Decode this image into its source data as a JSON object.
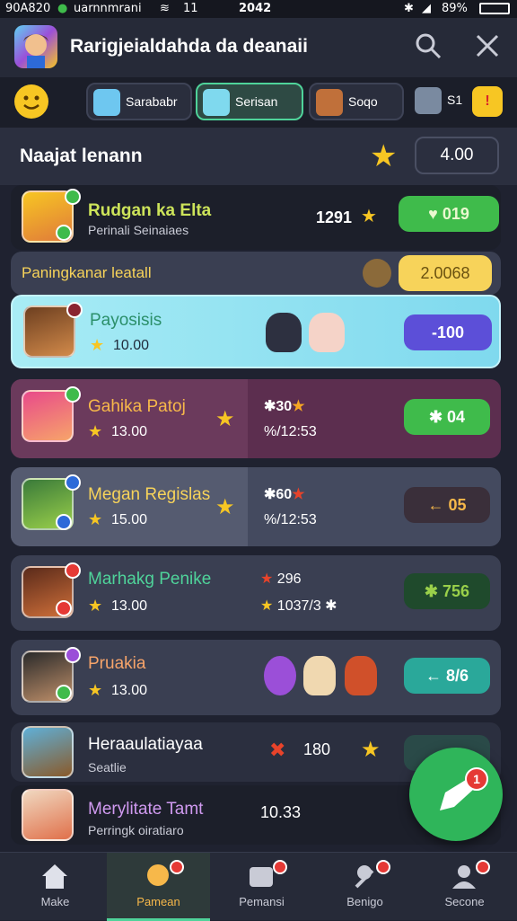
{
  "status": {
    "left": "90A820",
    "carrier": "uarnnmrani",
    "signal_num": "11",
    "time": "2042",
    "battery": "89%"
  },
  "header": {
    "title": "Rarigjeialdahda da deanaii"
  },
  "chips": [
    {
      "label": "Sarababr"
    },
    {
      "label": "Serisan"
    },
    {
      "label": "Soqo"
    },
    {
      "label": "S1"
    }
  ],
  "section": {
    "title": "Naajat lenann",
    "value": "4.00"
  },
  "rows": [
    {
      "name": "Rudgan ka Elta",
      "sub": "Perinali Seinaiaes",
      "score": "1291",
      "pill": "019",
      "name_color": "#cde45a",
      "pill_color": "#3fbb4b"
    },
    {
      "name": "Paningkanar leatall",
      "pill": "2.0068",
      "pill_color": "#f7d35a"
    },
    {
      "name": "Payosisis",
      "points": "10.00",
      "pill": "-100",
      "pill_color": "#5c4fd8"
    },
    {
      "name": "Gahika Patoj",
      "points": "13.00",
      "stat1": "30",
      "stat2": "/12:53",
      "pill": "04",
      "pill_color": "#3fbb4b"
    },
    {
      "name": "Megan Regislas",
      "points": "15.00",
      "stat1": "60",
      "stat2": "/12:53",
      "pill": "05",
      "pill_color": "#3a2f3a"
    },
    {
      "name": "Marhakg Penike",
      "points": "13.00",
      "stat1": "296",
      "stat2": "1037/3",
      "pill": "756",
      "pill_color": "#1f4a2c"
    },
    {
      "name": "Pruakia",
      "points": "13.00",
      "pill": "8/6",
      "pill_color": "#2aa89a"
    },
    {
      "name": "Heraaulatiayaa",
      "sub": "Seatlie",
      "score": "180"
    },
    {
      "name": "Merylitate Tamt",
      "sub": "Perringk oiratiaro",
      "score": "10.33"
    }
  ],
  "fab": {
    "badge": "1"
  },
  "nav": [
    {
      "label": "Make"
    },
    {
      "label": "Pamean"
    },
    {
      "label": "Pemansi"
    },
    {
      "label": "Benigo"
    },
    {
      "label": "Secone"
    }
  ],
  "colors": {
    "bg": "#1f2230",
    "accent": "#3fbb4b",
    "highlight_row": "#7fd9ee",
    "purple_row": "#5c2e4f"
  }
}
